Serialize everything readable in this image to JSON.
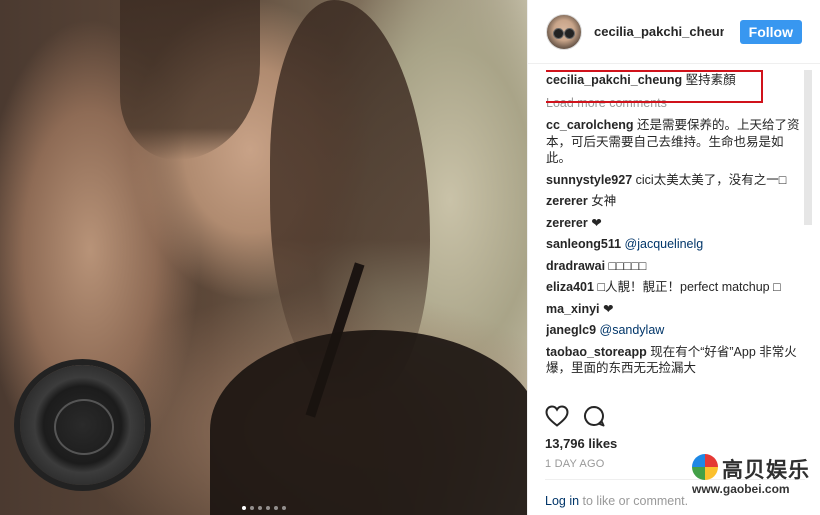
{
  "post": {
    "username": "cecilia_pakchi_cheung",
    "follow_label": "Follow",
    "caption_text": "堅持素顏",
    "load_more": "Load more comments",
    "comments": [
      {
        "user": "cc_carolcheng",
        "text": "还是需要保养的。上天给了资本，可后天需要自己去维持。生命也易是如此。"
      },
      {
        "user": "sunnystyle927",
        "text": "cici太美太美了，没有之一□"
      },
      {
        "user": "zererer",
        "text": "女神"
      },
      {
        "user": "zererer",
        "text": "❤"
      },
      {
        "user": "sanleong511",
        "text": "@jacquelinelg"
      },
      {
        "user": "dradrawai",
        "text": "□□□□□"
      },
      {
        "user": "eliza401",
        "text": "□人靚！靚正！perfect matchup □"
      },
      {
        "user": "ma_xinyi",
        "text": "❤"
      },
      {
        "user": "janeglc9",
        "text": "@sandylaw"
      },
      {
        "user": "taobao_storeapp",
        "text": "现在有个“好省”App 非常火爆，里面的东西无无捡漏大"
      }
    ],
    "likes": "13,796 likes",
    "time_ago": "1 DAY AGO",
    "login_link": "Log in",
    "login_suffix": " to like or comment."
  },
  "icons": {
    "like": "heart-icon",
    "comment": "comment-bubble-icon"
  },
  "watermark": {
    "name": "高贝娱乐",
    "url": "www.gaobei.com"
  },
  "colors": {
    "follow_bg": "#3897f0",
    "highlight_border": "#d0121b",
    "username_text": "#262626",
    "muted": "#999999"
  },
  "carousel": {
    "count": 6,
    "active_index": 0
  }
}
